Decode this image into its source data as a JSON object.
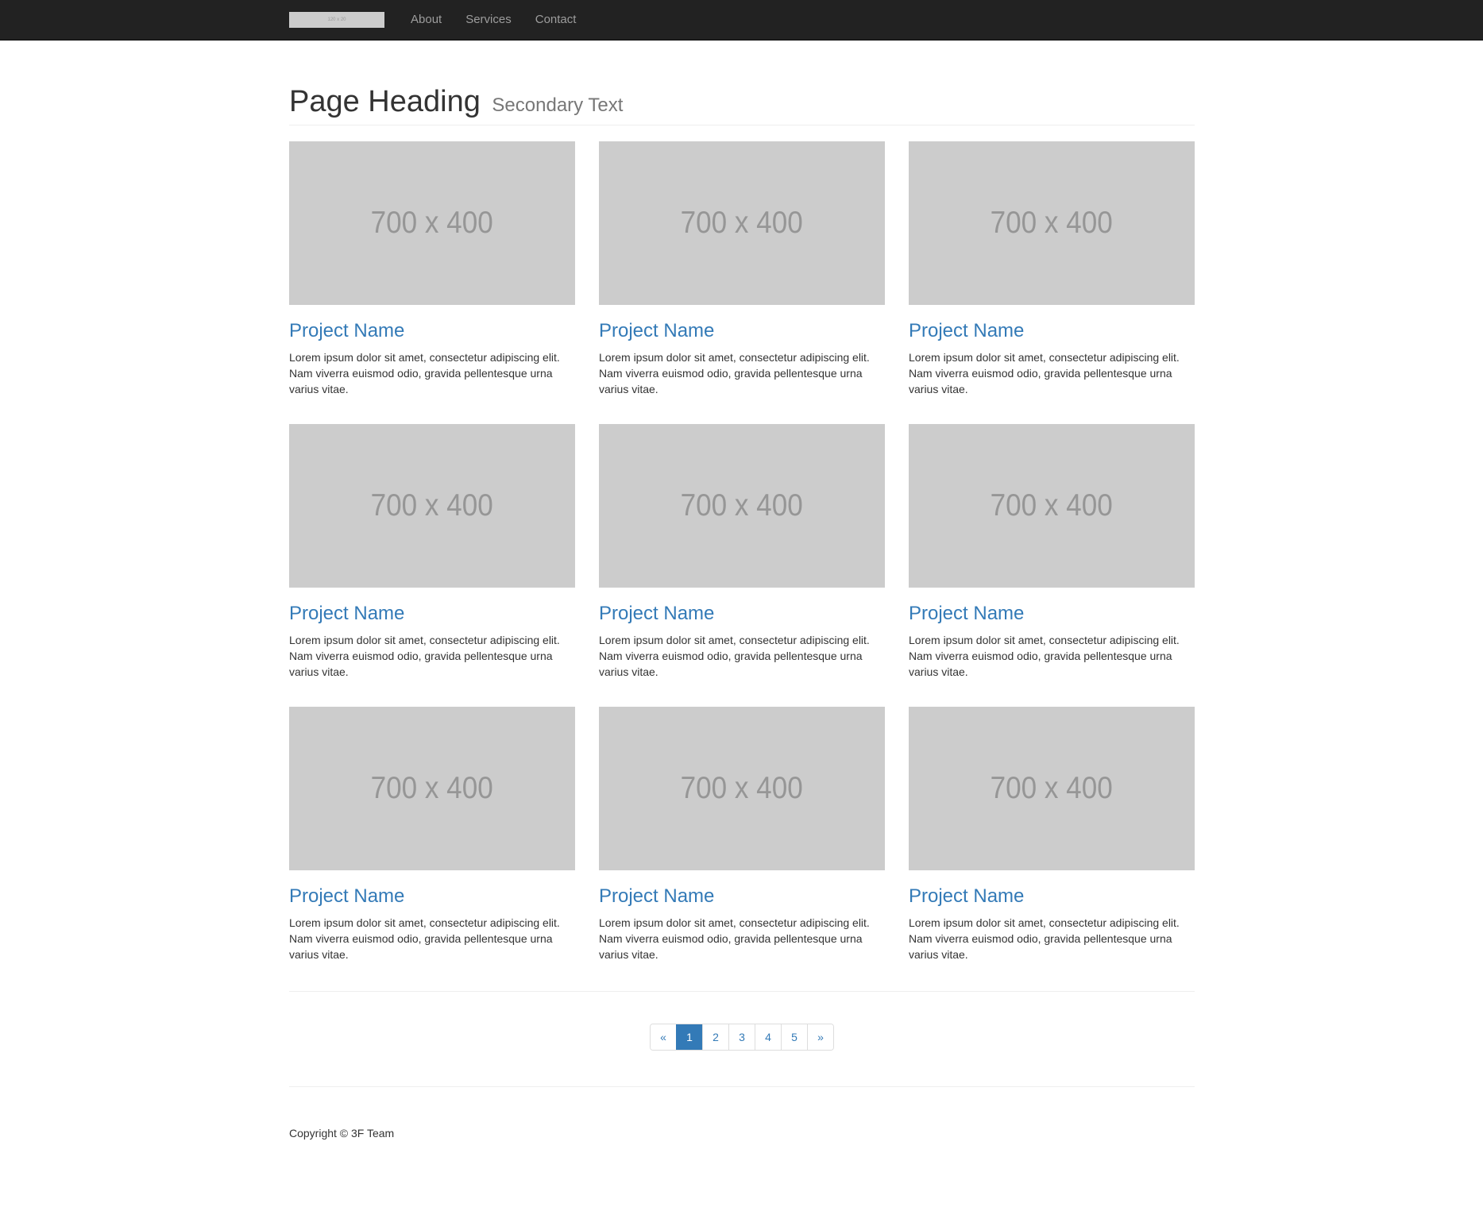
{
  "navbar": {
    "logo_text": "120 x 20",
    "links": [
      "About",
      "Services",
      "Contact"
    ]
  },
  "header": {
    "title": "Page Heading",
    "secondary": "Secondary Text"
  },
  "projects": [
    {
      "image_label": "700 x 400",
      "title": "Project Name",
      "description": "Lorem ipsum dolor sit amet, consectetur adipiscing elit. Nam viverra euismod odio, gravida pellentesque urna varius vitae."
    },
    {
      "image_label": "700 x 400",
      "title": "Project Name",
      "description": "Lorem ipsum dolor sit amet, consectetur adipiscing elit. Nam viverra euismod odio, gravida pellentesque urna varius vitae."
    },
    {
      "image_label": "700 x 400",
      "title": "Project Name",
      "description": "Lorem ipsum dolor sit amet, consectetur adipiscing elit. Nam viverra euismod odio, gravida pellentesque urna varius vitae."
    },
    {
      "image_label": "700 x 400",
      "title": "Project Name",
      "description": "Lorem ipsum dolor sit amet, consectetur adipiscing elit. Nam viverra euismod odio, gravida pellentesque urna varius vitae."
    },
    {
      "image_label": "700 x 400",
      "title": "Project Name",
      "description": "Lorem ipsum dolor sit amet, consectetur adipiscing elit. Nam viverra euismod odio, gravida pellentesque urna varius vitae."
    },
    {
      "image_label": "700 x 400",
      "title": "Project Name",
      "description": "Lorem ipsum dolor sit amet, consectetur adipiscing elit. Nam viverra euismod odio, gravida pellentesque urna varius vitae."
    },
    {
      "image_label": "700 x 400",
      "title": "Project Name",
      "description": "Lorem ipsum dolor sit amet, consectetur adipiscing elit. Nam viverra euismod odio, gravida pellentesque urna varius vitae."
    },
    {
      "image_label": "700 x 400",
      "title": "Project Name",
      "description": "Lorem ipsum dolor sit amet, consectetur adipiscing elit. Nam viverra euismod odio, gravida pellentesque urna varius vitae."
    },
    {
      "image_label": "700 x 400",
      "title": "Project Name",
      "description": "Lorem ipsum dolor sit amet, consectetur adipiscing elit. Nam viverra euismod odio, gravida pellentesque urna varius vitae."
    }
  ],
  "pagination": {
    "prev": "«",
    "pages": [
      "1",
      "2",
      "3",
      "4",
      "5"
    ],
    "active": "1",
    "next": "»"
  },
  "footer": {
    "copyright": "Copyright © 3F Team"
  },
  "colors": {
    "navbar_bg": "#222222",
    "link": "#337ab7",
    "placeholder_bg": "#cccccc"
  }
}
